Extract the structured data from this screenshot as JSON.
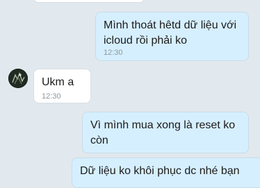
{
  "messages": [
    {
      "direction": "incoming",
      "text": "",
      "time": ""
    },
    {
      "direction": "outgoing",
      "text": "Mình thoát hêtd dữ liệu với icloud rồi phải ko",
      "time": "12:30"
    },
    {
      "direction": "incoming",
      "text": "Ukm a",
      "time": "12:30",
      "avatar": "contact-avatar"
    },
    {
      "direction": "outgoing",
      "text": "Vì mình mua xong là reset ko còn",
      "time": ""
    },
    {
      "direction": "outgoing",
      "text": "Dữ liệu ko khôi phục dc nhé bạn",
      "time": ""
    }
  ],
  "colors": {
    "background": "#e1e9ee",
    "outgoing_bubble": "#d6efff",
    "incoming_bubble": "#ffffff",
    "timestamp": "#8e979d"
  }
}
